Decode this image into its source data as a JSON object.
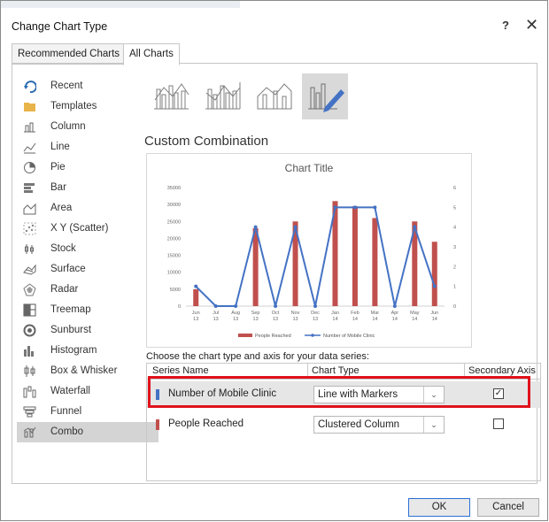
{
  "dialog": {
    "title": "Change Chart Type",
    "help": "?",
    "close": "✕"
  },
  "tabs": [
    "Recommended Charts",
    "All Charts"
  ],
  "sidebar": {
    "items": [
      {
        "label": "Recent",
        "icon": "recent-icon"
      },
      {
        "label": "Templates",
        "icon": "templates-folder-icon"
      },
      {
        "label": "Column",
        "icon": "column-chart-icon"
      },
      {
        "label": "Line",
        "icon": "line-chart-icon"
      },
      {
        "label": "Pie",
        "icon": "pie-chart-icon"
      },
      {
        "label": "Bar",
        "icon": "bar-chart-icon"
      },
      {
        "label": "Area",
        "icon": "area-chart-icon"
      },
      {
        "label": "X Y (Scatter)",
        "icon": "scatter-chart-icon"
      },
      {
        "label": "Stock",
        "icon": "stock-chart-icon"
      },
      {
        "label": "Surface",
        "icon": "surface-chart-icon"
      },
      {
        "label": "Radar",
        "icon": "radar-chart-icon"
      },
      {
        "label": "Treemap",
        "icon": "treemap-chart-icon"
      },
      {
        "label": "Sunburst",
        "icon": "sunburst-chart-icon"
      },
      {
        "label": "Histogram",
        "icon": "histogram-chart-icon"
      },
      {
        "label": "Box & Whisker",
        "icon": "box-whisker-chart-icon"
      },
      {
        "label": "Waterfall",
        "icon": "waterfall-chart-icon"
      },
      {
        "label": "Funnel",
        "icon": "funnel-chart-icon"
      },
      {
        "label": "Combo",
        "icon": "combo-chart-icon"
      }
    ],
    "selected": "Combo"
  },
  "subtypes": [
    "clustered-column-line",
    "clustered-column-line-secondary",
    "stacked-area-clustered-column",
    "custom-combination"
  ],
  "section_title": "Custom Combination",
  "preview": {
    "chart_data": {
      "type": "bar",
      "title": "Chart Title",
      "categories": [
        "Jun 13",
        "Jul 13",
        "Aug 13",
        "Sep 13",
        "Oct 13",
        "Nov 13",
        "Dec 13",
        "Jan 14",
        "Feb 14",
        "Mar 14",
        "Apr 14",
        "May 14",
        "Jun 14"
      ],
      "series": [
        {
          "name": "People Reached",
          "kind": "column",
          "axis": "primary",
          "color": "#c0504d",
          "values": [
            5000,
            0,
            0,
            23000,
            0,
            25000,
            0,
            31000,
            29500,
            26000,
            0,
            25000,
            19000
          ]
        },
        {
          "name": "Number of Mobile Clinic",
          "kind": "line",
          "axis": "secondary",
          "color": "#4472c4",
          "values": [
            1,
            0,
            0,
            4,
            0,
            4,
            0,
            5,
            5,
            5,
            0,
            4,
            1
          ]
        }
      ],
      "ylim": [
        0,
        35000
      ],
      "yticks": [
        "35000",
        "30000",
        "25000",
        "20000",
        "15000",
        "10000",
        "5000",
        "0"
      ],
      "y2lim": [
        0,
        6
      ],
      "y2ticks": [
        "6",
        "5",
        "4",
        "3",
        "2",
        "1",
        "0"
      ],
      "legend": "bottom"
    }
  },
  "series_grid": {
    "label": "Choose the chart type and axis for your data series:",
    "headers": [
      "Series Name",
      "Chart Type",
      "Secondary Axis"
    ],
    "rows": [
      {
        "name": "Number of Mobile Clinic",
        "color": "#4472c4",
        "chart_type": "Line with Markers",
        "secondary": true
      },
      {
        "name": "People Reached",
        "color": "#c0504d",
        "chart_type": "Clustered Column",
        "secondary": false
      }
    ]
  },
  "buttons": {
    "ok": "OK",
    "cancel": "Cancel"
  }
}
